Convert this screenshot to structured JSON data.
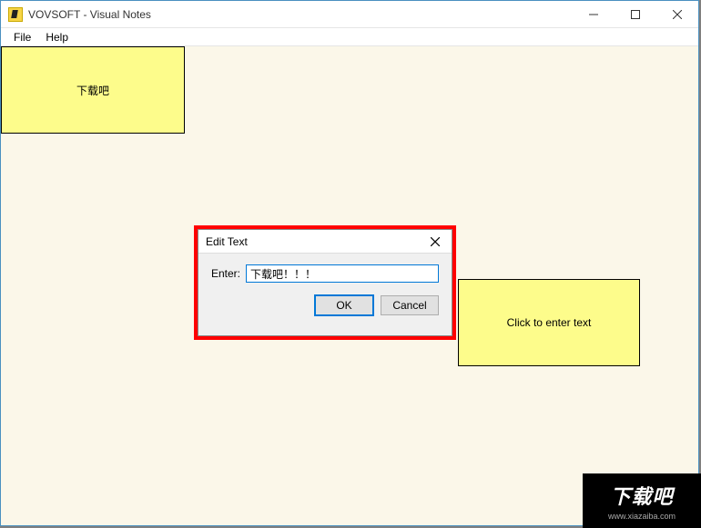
{
  "window": {
    "title": "VOVSOFT - Visual Notes"
  },
  "menu": {
    "file": "File",
    "help": "Help"
  },
  "notes": {
    "n1": "下载吧",
    "n2": "Click to enter text"
  },
  "dialog": {
    "title": "Edit Text",
    "label": "Enter:",
    "value": "下载吧！！！",
    "ok": "OK",
    "cancel": "Cancel"
  },
  "watermark": {
    "brand": "下载吧",
    "url": "www.xiazaiba.com"
  }
}
